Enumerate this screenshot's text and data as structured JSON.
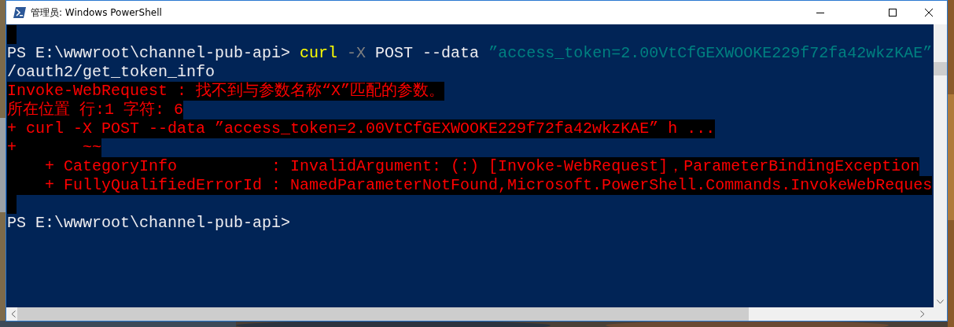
{
  "window": {
    "title": "管理员: Windows PowerShell"
  },
  "console": {
    "lines": [
      {
        "kind": "highlight"
      },
      {
        "kind": "output",
        "segments": [
          {
            "kind": "plain",
            "text": "PS E:\\wwwroot\\channel-pub-api> "
          },
          {
            "kind": "command",
            "text": "curl"
          },
          {
            "kind": "parameter",
            "text": " -X"
          },
          {
            "kind": "plain",
            "text": " POST --data "
          },
          {
            "kind": "string",
            "text": "”access_token=2.00VtCfGEXWOOKE229f72fa42wkzKAE”"
          }
        ]
      },
      {
        "kind": "output",
        "segments": [
          {
            "kind": "plain",
            "text": "/oauth2/get_token_info"
          }
        ]
      },
      {
        "kind": "error",
        "segments": [
          {
            "kind": "error",
            "text": "Invoke-WebRequest : 找不到与参数名称“X”匹配的参数。"
          }
        ]
      },
      {
        "kind": "error",
        "segments": [
          {
            "kind": "error",
            "text": "所在位置 行:1 字符: 6"
          }
        ]
      },
      {
        "kind": "error",
        "segments": [
          {
            "kind": "error",
            "text": "+ curl -X POST --data ”access_token=2.00VtCfGEXWOOKE229f72fa42wkzKAE” h ..."
          }
        ]
      },
      {
        "kind": "error",
        "segments": [
          {
            "kind": "error",
            "text": "+       ~~"
          }
        ]
      },
      {
        "kind": "error",
        "segments": [
          {
            "kind": "error",
            "text": "    + CategoryInfo          : InvalidArgument: (:) [Invoke-WebRequest]，ParameterBindingException"
          }
        ]
      },
      {
        "kind": "error",
        "segments": [
          {
            "kind": "error",
            "text": "    + FullyQualifiedErrorId : NamedParameterNotFound,Microsoft.PowerShell.Commands.InvokeWebReques"
          }
        ]
      },
      {
        "kind": "highlight"
      },
      {
        "kind": "output",
        "segments": [
          {
            "kind": "plain",
            "text": "PS E:\\wwwroot\\channel-pub-api>"
          }
        ]
      }
    ]
  }
}
